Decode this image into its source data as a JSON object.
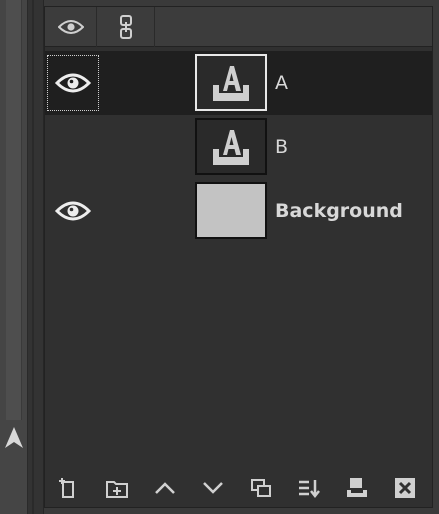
{
  "colors": {
    "panel_bg": "#303030",
    "selected_row": "#1f1f1f",
    "icon": "#d0d0d0",
    "thumb_fill": "#c3c3c3"
  },
  "header": {
    "visibility_icon": "eye-icon",
    "link_icon": "chain-icon"
  },
  "layers": [
    {
      "name": "A",
      "visible": true,
      "selected": true,
      "type": "text",
      "icon": "text-layer-icon"
    },
    {
      "name": "B",
      "visible": false,
      "selected": false,
      "type": "text",
      "icon": "text-layer-icon"
    },
    {
      "name": "Background",
      "visible": true,
      "selected": false,
      "type": "raster",
      "bold": true
    }
  ],
  "footer": {
    "buttons": [
      "new-layer",
      "new-layer-group",
      "raise-layer",
      "lower-layer",
      "duplicate-layer",
      "merge-down",
      "anchor-layer",
      "delete-layer"
    ]
  }
}
